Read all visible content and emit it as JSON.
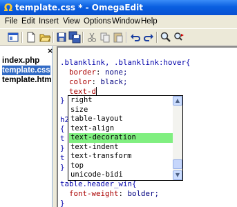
{
  "window": {
    "title": "template.css * - OmegaEdit",
    "app_icon": "omega-icon"
  },
  "menu": [
    "File",
    "Edit",
    "Insert",
    "View",
    "Options",
    "Window",
    "Help"
  ],
  "toolbar_icons": [
    "window-icon",
    "new-file-icon",
    "open-folder-icon",
    "save-icon",
    "save-all-icon",
    "cut-icon",
    "copy-icon",
    "paste-icon",
    "undo-icon",
    "redo-icon",
    "find-icon",
    "replace-icon"
  ],
  "files": [
    {
      "name": "index.php",
      "selected": false
    },
    {
      "name": "template.css",
      "selected": true
    },
    {
      "name": "template.htm",
      "selected": false
    }
  ],
  "panel_close": "×",
  "code": {
    "line1_selector": ".blanklink, .blanklink:hover{",
    "line2_prop": "border",
    "line2_val": " none;",
    "line3_prop": "color",
    "line3_val": " black;",
    "line4_text": "text-d",
    "line5": "}",
    "line6": "h2",
    "line7": "{",
    "line8": "t",
    "line9": "}",
    "line10": "t",
    "line11": "}",
    "line12": "table.header_win{",
    "line13_prop": "font-weight",
    "line13_val": " bolder;",
    "line14": "}"
  },
  "autocomplete": {
    "items": [
      "right",
      "size",
      "table-layout",
      "text-align",
      "text-decoration",
      "text-indent",
      "text-transform",
      "top",
      "unicode-bidi"
    ],
    "selected_index": 4,
    "scroll_up": "▲",
    "scroll_down": "▼"
  }
}
